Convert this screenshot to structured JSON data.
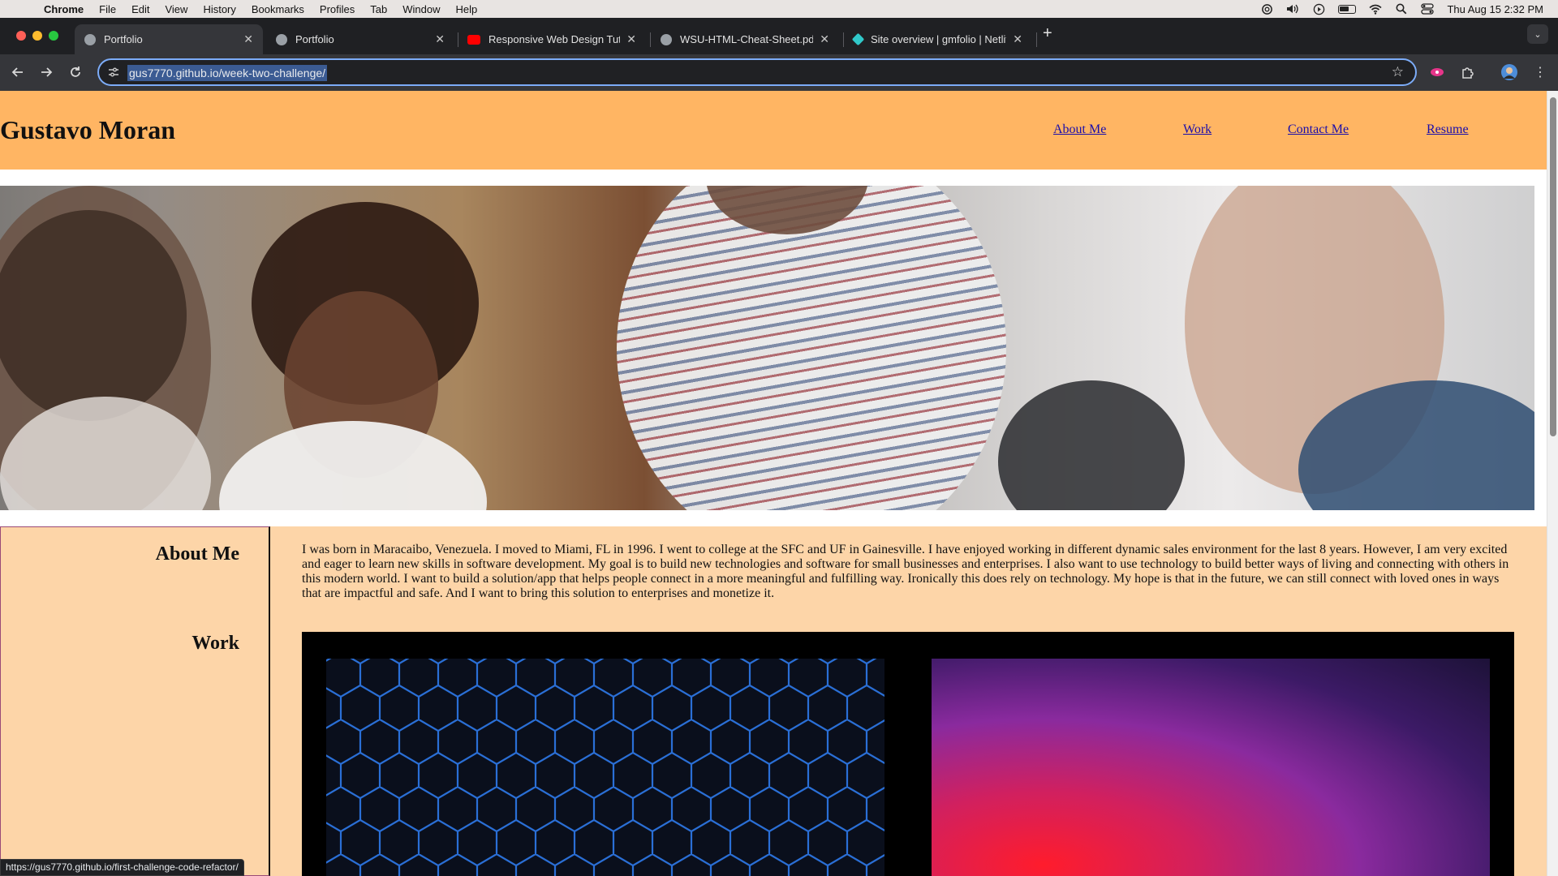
{
  "menubar": {
    "app": "Chrome",
    "items": [
      "File",
      "Edit",
      "View",
      "History",
      "Bookmarks",
      "Profiles",
      "Tab",
      "Window",
      "Help"
    ],
    "clock": "Thu Aug 15  2:32 PM"
  },
  "tabs": [
    {
      "title": "Portfolio",
      "favicon": "globe-icon"
    },
    {
      "title": "Portfolio",
      "favicon": "globe-icon"
    },
    {
      "title": "Responsive Web Design Tutor",
      "favicon": "youtube-icon"
    },
    {
      "title": "WSU-HTML-Cheat-Sheet.pdf",
      "favicon": "globe-icon"
    },
    {
      "title": "Site overview | gmfolio | Netlif",
      "favicon": "netlify-icon"
    }
  ],
  "toolbar": {
    "url": "gus7770.github.io/week-two-challenge/"
  },
  "site": {
    "title": "Gustavo Moran",
    "nav": [
      "About Me",
      "Work",
      "Contact Me",
      "Resume"
    ],
    "sidebar": [
      "About Me",
      "Work"
    ],
    "about": "I was born in Maracaibo, Venezuela. I moved to Miami, FL in 1996. I went to college at the SFC and UF in Gainesville. I have enjoyed working in different dynamic sales environment for the last 8 years. However, I am very excited and eager to learn new skills in software development. My goal is to build new technologies and software for small businesses and enterprises. I also want to use technology to build better ways of living and connecting with others in this modern world. I want to build a solution/app that helps people connect in a more meaningful and fulfilling way. Ironically this does rely on technology. My hope is that in the future, we can still connect with loved ones in ways that are impactful and safe. And I want to bring this solution to enterprises and monetize it."
  },
  "status": {
    "hover_url": "https://gus7770.github.io/first-challenge-code-refactor/"
  },
  "colors": {
    "header_bg": "#ffb563",
    "content_bg": "#fdd5a8",
    "link": "#1a0dab",
    "hex_line": "#2a6fd6"
  }
}
